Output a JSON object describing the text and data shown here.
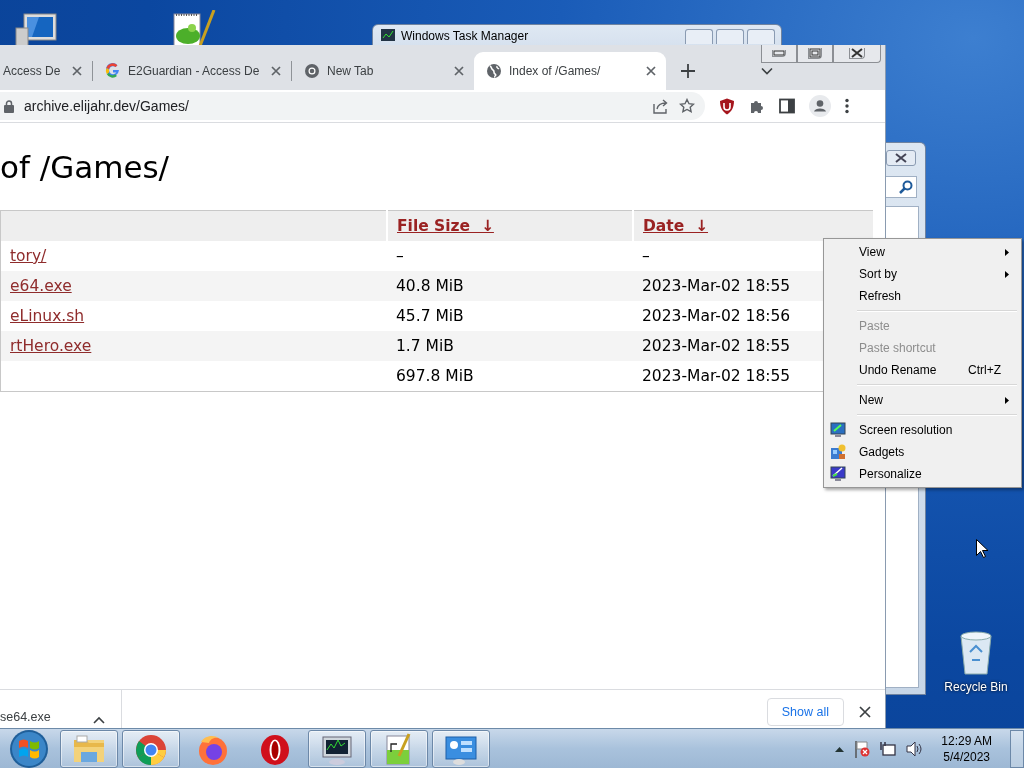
{
  "background_window": {
    "title": "Windows Task Manager"
  },
  "browser": {
    "tabs": [
      {
        "kind": "plain",
        "title": "Access De",
        "selected": false
      },
      {
        "kind": "google",
        "title": "E2Guardian - Access De",
        "selected": false
      },
      {
        "kind": "chrome",
        "title": "New Tab",
        "selected": false
      },
      {
        "kind": "globe",
        "title": "Index of /Games/",
        "selected": true
      }
    ],
    "url": "archive.elijahr.dev/Games/",
    "page": {
      "heading": "of /Games/",
      "columns": [
        {
          "label": "File Size",
          "arrow": "↓"
        },
        {
          "label": "Date",
          "arrow": "↓"
        }
      ],
      "rows": [
        {
          "name": "tory/",
          "size": "–",
          "date": "–"
        },
        {
          "name": "e64.exe",
          "size": "40.8 MiB",
          "date": "2023-Mar-02 18:55"
        },
        {
          "name": "eLinux.sh",
          "size": "45.7 MiB",
          "date": "2023-Mar-02 18:56"
        },
        {
          "name": "rtHero.exe",
          "size": "1.7 MiB",
          "date": "2023-Mar-02 18:55"
        },
        {
          "size": "697.8 MiB",
          "date": "2023-Mar-02 18:55"
        }
      ]
    },
    "download_bar": {
      "file": "se64.exe",
      "show_all": "Show all"
    }
  },
  "context_menu": {
    "items": [
      {
        "kind": "submenu",
        "label": "View",
        "disabled": false
      },
      {
        "kind": "submenu",
        "label": "Sort by",
        "disabled": false
      },
      {
        "kind": "item",
        "label": "Refresh",
        "disabled": false
      },
      {
        "kind": "separator"
      },
      {
        "kind": "item",
        "label": "Paste",
        "disabled": true
      },
      {
        "kind": "item",
        "label": "Paste shortcut",
        "disabled": true
      },
      {
        "kind": "item",
        "label": "Undo Rename",
        "shortcut": "Ctrl+Z",
        "disabled": false
      },
      {
        "kind": "separator"
      },
      {
        "kind": "submenu",
        "label": "New",
        "disabled": false
      },
      {
        "kind": "separator"
      },
      {
        "kind": "icon-item",
        "label": "Screen resolution",
        "disabled": false
      },
      {
        "kind": "icon-item",
        "label": "Gadgets",
        "disabled": false
      },
      {
        "kind": "icon-item",
        "label": "Personalize",
        "disabled": false
      }
    ]
  },
  "recycle_bin": {
    "label": "Recycle Bin"
  },
  "taskbar": {
    "buttons": [
      {
        "kind": "explorer",
        "running": true
      },
      {
        "kind": "chrome",
        "running": true
      },
      {
        "kind": "firefox",
        "running": false
      },
      {
        "kind": "opera",
        "running": false
      },
      {
        "kind": "monitor",
        "running": true
      },
      {
        "kind": "notepad",
        "running": true
      },
      {
        "kind": "panel",
        "running": true
      }
    ],
    "time": "12:29 AM",
    "date": "5/4/2023"
  }
}
